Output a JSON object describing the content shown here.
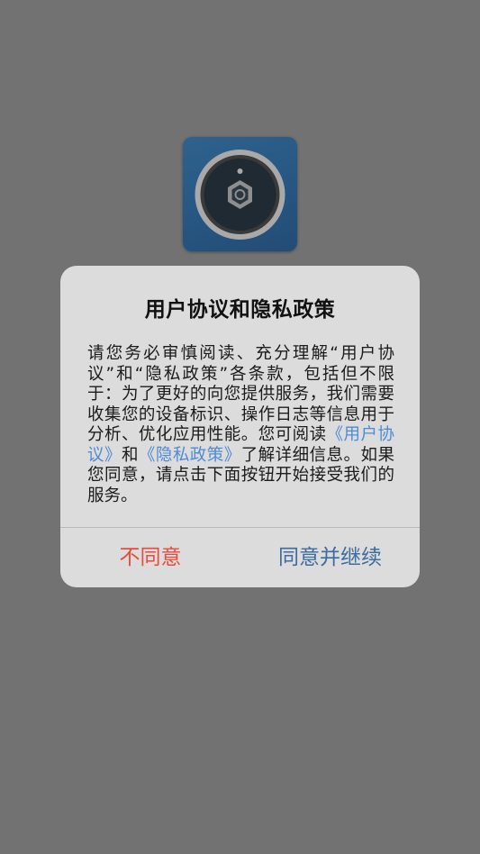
{
  "app_icon": {
    "name": "camera-lens-icon",
    "accent_color": "#2f628d"
  },
  "dialog": {
    "title": "用户协议和隐私政策",
    "body_before": "请您务必审慎阅读、充分理解“用户协议”和“隐私政策”各条款，包括但不限于：为了更好的向您提供服务，我们需要收集您的设备标识、操作日志等信息用于分析、优化应用性能。您可阅读",
    "link_user_agreement": "《用户协议》",
    "connector": "和",
    "link_privacy_policy": "《隐私政策》",
    "body_after": "了解详细信息。如果您同意，请点击下面按钮开始接受我们的服务。",
    "decline_label": "不同意",
    "accept_label": "同意并继续",
    "colors": {
      "decline": "#e74b3c",
      "accept": "#3d6c9e",
      "link": "#4e8bd6"
    }
  }
}
